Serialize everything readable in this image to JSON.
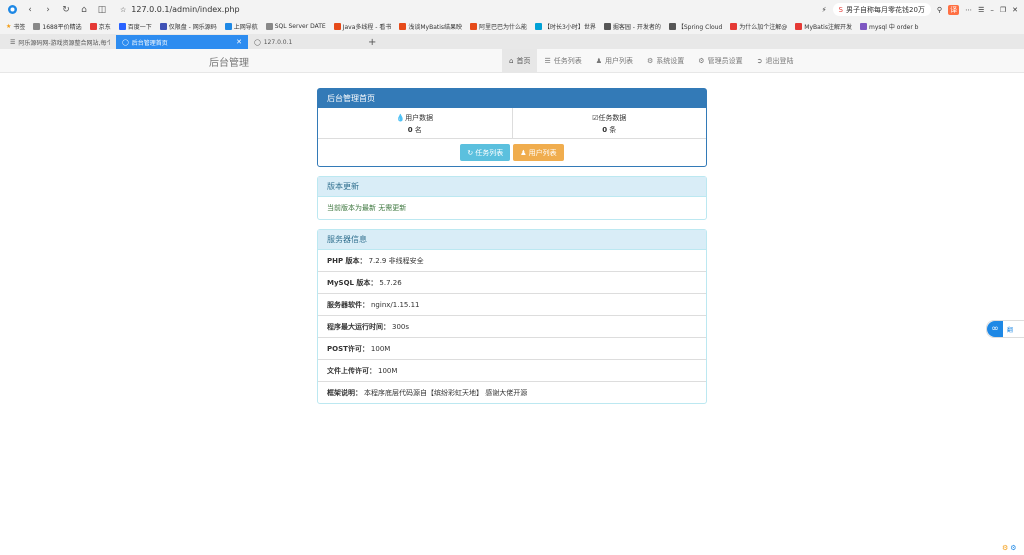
{
  "browser": {
    "url": "127.0.0.1/admin/index.php",
    "search_text": "男子自称每月零花钱20万",
    "bookmarks": [
      "书签",
      "1688平价精选",
      "京东",
      "百度一下",
      "仅限盘 - 网乐源码",
      "上网导航",
      "SQL Server DATE",
      "Java多线程 - 看书",
      "浅谈MyBatis结果映",
      "阿里巴巴为什么能",
      "【时长3小时】世界",
      "掘客园 - 开发者的",
      "【Spring Cloud",
      "为什么加个注解@",
      "MyBatis注解开发",
      "mysql 中 order b"
    ],
    "tabs": [
      {
        "label": "阿乐源码网-游戏资源整合网站,每个资"
      },
      {
        "label": "后台管理首页"
      },
      {
        "label": "127.0.0.1"
      }
    ]
  },
  "navbar": {
    "brand": "后台管理",
    "items": [
      {
        "label": "首页",
        "icon": "home-icon"
      },
      {
        "label": "任务列表",
        "icon": "list-icon"
      },
      {
        "label": "用户列表",
        "icon": "user-icon"
      },
      {
        "label": "系统设置",
        "icon": "gear-icon"
      },
      {
        "label": "管理员设置",
        "icon": "gear-icon"
      },
      {
        "label": "退出登陆",
        "icon": "logout-icon"
      }
    ]
  },
  "home_panel": {
    "title": "后台管理首页",
    "user_count": {
      "label": "用户数据",
      "value": "0",
      "unit": "名"
    },
    "task_count": {
      "label": "任务数据",
      "value": "0",
      "unit": "条"
    },
    "btn_tasks": "任务列表",
    "btn_users": "用户列表"
  },
  "update_panel": {
    "title": "版本更新",
    "message": "当前版本为最新 无需更新"
  },
  "server_panel": {
    "title": "服务器信息",
    "rows": [
      {
        "label": "PHP 版本：",
        "value": "7.2.9 非线程安全"
      },
      {
        "label": "MySQL 版本：",
        "value": "5.7.26"
      },
      {
        "label": "服务器软件：",
        "value": "nginx/1.15.11"
      },
      {
        "label": "程序最大运行时间：",
        "value": "300s"
      },
      {
        "label": "POST许可：",
        "value": "100M"
      },
      {
        "label": "文件上传许可：",
        "value": "100M"
      },
      {
        "label": "框架说明：",
        "value": "本程序底层代码源自【缤纷彩虹天地】 感谢大佬开源"
      }
    ]
  },
  "float_button": {
    "label": "翻"
  },
  "colors": {
    "primary": "#337ab7",
    "info_bg": "#d9edf7",
    "btn_info": "#5bc0de",
    "btn_warning": "#f0ad4e",
    "success_text": "#3c763d"
  }
}
